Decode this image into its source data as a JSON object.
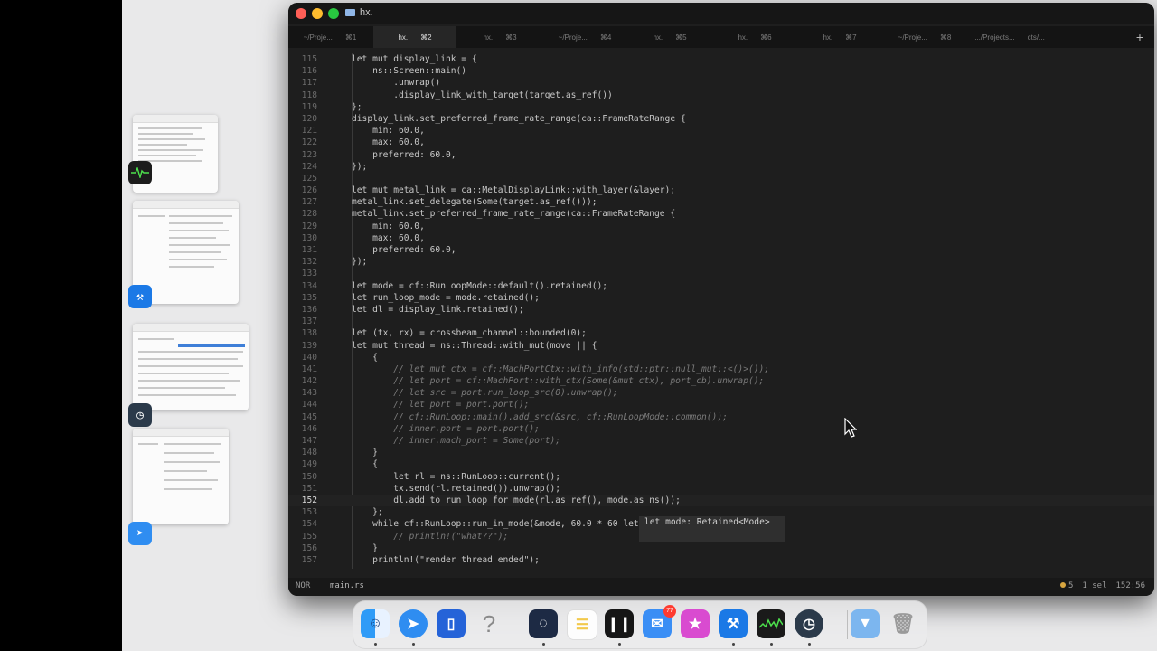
{
  "window": {
    "title": "hx."
  },
  "tabs": [
    {
      "label": "~/Proje...",
      "shortcut": "⌘1",
      "active": false
    },
    {
      "label": "hx.",
      "shortcut": "⌘2",
      "active": true
    },
    {
      "label": "hx.",
      "shortcut": "⌘3",
      "active": false
    },
    {
      "label": "~/Proje...",
      "shortcut": "⌘4",
      "active": false
    },
    {
      "label": "hx.",
      "shortcut": "⌘5",
      "active": false
    },
    {
      "label": "hx.",
      "shortcut": "⌘6",
      "active": false
    },
    {
      "label": "hx.",
      "shortcut": "⌘7",
      "active": false
    },
    {
      "label": "~/Proje...",
      "shortcut": "⌘8",
      "active": false
    },
    {
      "label": ".../Projects...",
      "shortcut": "cts/...",
      "active": false
    }
  ],
  "tab_add_label": "+",
  "code": {
    "lines": [
      {
        "n": "115",
        "t": "let mut display_link = {"
      },
      {
        "n": "116",
        "t": "    ns::Screen::main()"
      },
      {
        "n": "117",
        "t": "        .unwrap()"
      },
      {
        "n": "118",
        "t": "        .display_link_with_target(target.as_ref())"
      },
      {
        "n": "119",
        "t": "};"
      },
      {
        "n": "120",
        "t": "display_link.set_preferred_frame_rate_range(ca::FrameRateRange {"
      },
      {
        "n": "121",
        "t": "    min: 60.0,"
      },
      {
        "n": "122",
        "t": "    max: 60.0,"
      },
      {
        "n": "123",
        "t": "    preferred: 60.0,"
      },
      {
        "n": "124",
        "t": "});"
      },
      {
        "n": "125",
        "t": ""
      },
      {
        "n": "126",
        "t": "let mut metal_link = ca::MetalDisplayLink::with_layer(&layer);"
      },
      {
        "n": "127",
        "t": "metal_link.set_delegate(Some(target.as_ref()));"
      },
      {
        "n": "128",
        "t": "metal_link.set_preferred_frame_rate_range(ca::FrameRateRange {"
      },
      {
        "n": "129",
        "t": "    min: 60.0,"
      },
      {
        "n": "130",
        "t": "    max: 60.0,"
      },
      {
        "n": "131",
        "t": "    preferred: 60.0,"
      },
      {
        "n": "132",
        "t": "});"
      },
      {
        "n": "133",
        "t": ""
      },
      {
        "n": "134",
        "t": "let mode = cf::RunLoopMode::default().retained();"
      },
      {
        "n": "135",
        "t": "let run_loop_mode = mode.retained();"
      },
      {
        "n": "136",
        "t": "let dl = display_link.retained();"
      },
      {
        "n": "137",
        "t": ""
      },
      {
        "n": "138",
        "t": "let (tx, rx) = crossbeam_channel::bounded(0);"
      },
      {
        "n": "139",
        "t": "let mut thread = ns::Thread::with_mut(move || {"
      },
      {
        "n": "140",
        "t": "    {"
      },
      {
        "n": "141",
        "t": "        // let mut ctx = cf::MachPortCtx::with_info(std::ptr::null_mut::<()>());"
      },
      {
        "n": "142",
        "t": "        // let port = cf::MachPort::with_ctx(Some(&mut ctx), port_cb).unwrap();"
      },
      {
        "n": "143",
        "t": "        // let src = port.run_loop_src(0).unwrap();"
      },
      {
        "n": "144",
        "t": "        // let port = port.port();"
      },
      {
        "n": "145",
        "t": "        // cf::RunLoop::main().add_src(&src, cf::RunLoopMode::common());"
      },
      {
        "n": "146",
        "t": "        // inner.port = port.port();"
      },
      {
        "n": "147",
        "t": "        // inner.mach_port = Some(port);"
      },
      {
        "n": "148",
        "t": "    }"
      },
      {
        "n": "149",
        "t": "    {"
      },
      {
        "n": "150",
        "t": "        let rl = ns::RunLoop::current();"
      },
      {
        "n": "151",
        "t": "        tx.send(rl.retained()).unwrap();"
      },
      {
        "n": "152",
        "t": "        dl.add_to_run_loop_for_mode(rl.as_ref(), mode.as_ns());"
      },
      {
        "n": "153",
        "t": "    };"
      },
      {
        "n": "154",
        "t": "    while cf::RunLoop::run_in_mode(&mode, 60.0 * 60 let mode: Retained<Mode> ut() {"
      },
      {
        "n": "155",
        "t": "        // println!(\"what??\");"
      },
      {
        "n": "156",
        "t": "    }"
      },
      {
        "n": "157",
        "t": "    println!(\"render thread ended\");"
      }
    ],
    "hover_popup": "let mode: Retained<Mode>"
  },
  "status": {
    "mode": "NOR",
    "file": "main.rs",
    "diagnostics": "5",
    "selection": "1 sel",
    "position": "152:56"
  },
  "dock": {
    "mail_badge": "77",
    "help_glyph": "?"
  },
  "colors": {
    "editor_bg": "#1e1e1e",
    "keyword": "#d28bd8",
    "type": "#d8b36a",
    "comment": "#7b7b7b",
    "close": "#ff5f57",
    "minimize": "#febc2e",
    "zoom": "#28c840"
  }
}
